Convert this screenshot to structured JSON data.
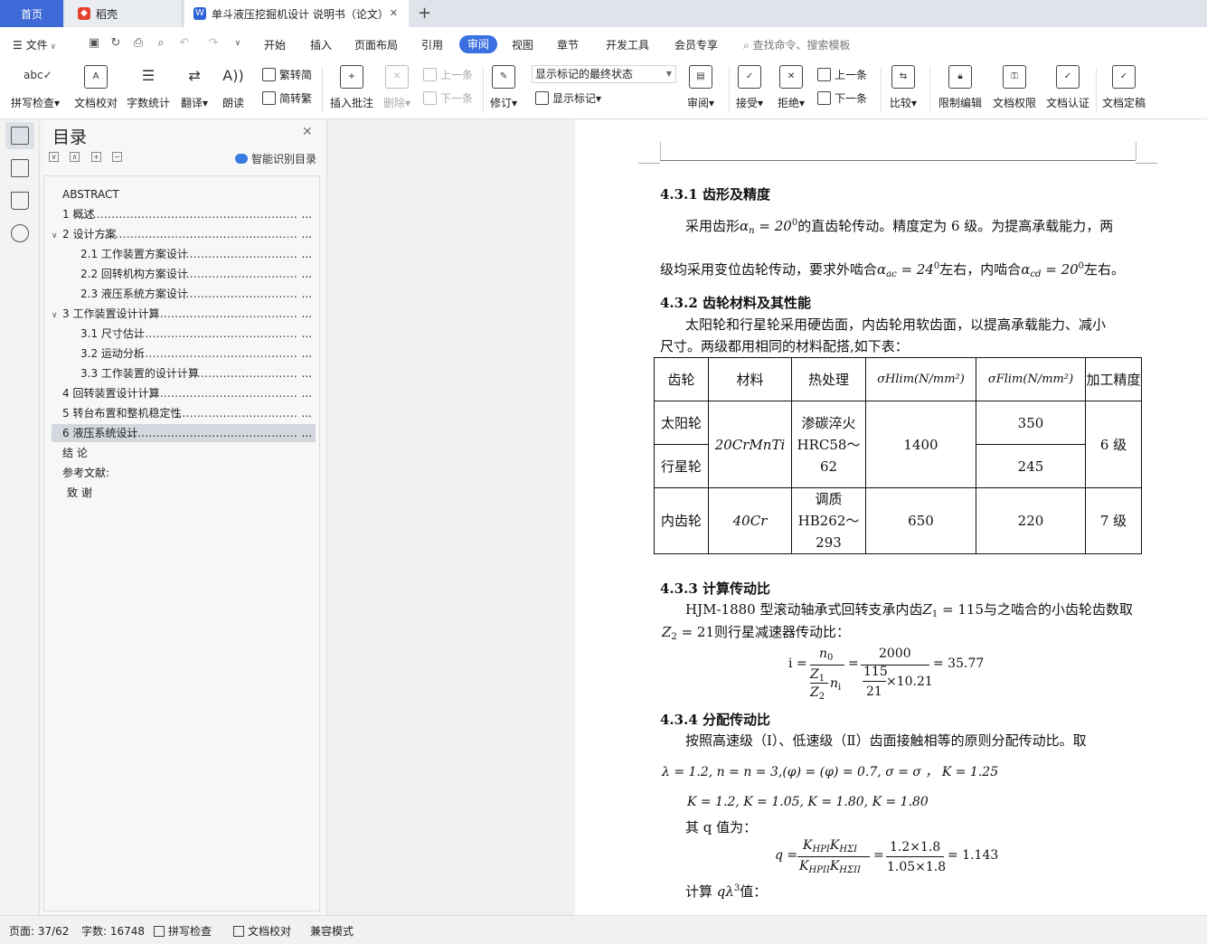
{
  "tabs": {
    "home": "首页",
    "daoke": "稻壳",
    "doc": "单斗液压挖掘机设计 说明书（论文）",
    "add": "+"
  },
  "menu": {
    "file": "文件",
    "items": [
      "开始",
      "插入",
      "页面布局",
      "引用",
      "审阅",
      "视图",
      "章节",
      "开发工具",
      "会员专享"
    ],
    "active": "审阅",
    "search": "查找命令、搜索模板"
  },
  "toolbar": {
    "spell": "拼写检查",
    "proof": "文档校对",
    "wordcount": "字数统计",
    "translate": "翻译",
    "read": "朗读",
    "to_trad": "繁转简",
    "to_simp": "简转繁",
    "insert_comment": "插入批注",
    "delete": "删除",
    "prev": "上一条",
    "next": "下一条",
    "revise": "修订",
    "markup_state": "显示标记的最终状态",
    "show_markup": "显示标记",
    "review": "审阅",
    "accept": "接受",
    "reject": "拒绝",
    "prev2": "上一条",
    "next2": "下一条",
    "compare": "比较",
    "restrict": "限制编辑",
    "permission": "文档权限",
    "certify": "文档认证",
    "finalize": "文档定稿"
  },
  "toc": {
    "title": "目录",
    "smart": "智能识别目录",
    "items": [
      {
        "label": "ABSTRACT",
        "end": ""
      },
      {
        "label": "1  概述",
        "end": "..."
      },
      {
        "label": "2  设计方案",
        "end": "..."
      },
      {
        "label": "2.1  工作装置方案设计",
        "end": "..."
      },
      {
        "label": "2.2  回转机构方案设计",
        "end": "..."
      },
      {
        "label": "2.3  液压系统方案设计",
        "end": "..."
      },
      {
        "label": "3  工作装置设计计算",
        "end": "..."
      },
      {
        "label": "3.1  尺寸估计",
        "end": "..."
      },
      {
        "label": "3.2  运动分析",
        "end": "..."
      },
      {
        "label": "3.3  工作装置的设计计算",
        "end": "..."
      },
      {
        "label": "4  回转装置设计计算",
        "end": "..."
      },
      {
        "label": "5  转台布置和整机稳定性",
        "end": "..."
      },
      {
        "label": "6  液压系统设计",
        "end": "..."
      },
      {
        "label": "结    论",
        "end": ""
      },
      {
        "label": "参考文献:",
        "end": ""
      },
      {
        "label": "致    谢",
        "end": ""
      }
    ]
  },
  "doc": {
    "h431": "4.3.1 齿形及精度",
    "p431a_1": "采用齿形",
    "p431a_2": "的直齿轮传动。精度定为 6 级。为提高承载能力，两",
    "alpha_n": "α",
    "alpha_n_sub": "n",
    "alpha_val": " = 20",
    "deg": "0",
    "p431b_1": "级均采用变位齿轮传动，要求外啮合",
    "p431b_2": "左右，内啮合",
    "p431b_3": "左右。",
    "ext_val": " = 24",
    "int_val": " = 20",
    "h432": "4.3.2 齿轮材料及其性能",
    "p432a": "太阳轮和行星轮采用硬齿面，内齿轮用软齿面，以提高承载能力、减小",
    "p432b": "尺寸。两级都用相同的材料配搭,如下表：",
    "table": {
      "headers": [
        "齿轮",
        "材料",
        "热处理",
        "σHlim(N/mm²)",
        "σFlim(N/mm²)",
        "加工精度"
      ],
      "r1_gear": "太阳轮",
      "r2_gear": "行星轮",
      "r12_material": "20CrMnTi",
      "r12_heat": "渗碳淬火HRC58～62",
      "r12_hlim": "1400",
      "r1_flim": "350",
      "r2_flim": "245",
      "r12_prec": "6 级",
      "r3_gear": "内齿轮",
      "r3_material": "40Cr",
      "r3_heat": "调质HB262～293",
      "r3_hlim": "650",
      "r3_flim": "220",
      "r3_prec": "7 级"
    },
    "h433": "4.3.3 计算传动比",
    "p433a_1": "HJM-1880 型滚动轴承式回转支承内齿",
    "p433a_z1": "Z",
    "p433a_z1v": " = 115",
    "p433a_2": "与之啮合的小齿轮齿数取",
    "p433b_z2v": " = 21",
    "p433b_2": "则行星减速器传动比：",
    "eq_i": "i =",
    "eq_n0": "n",
    "eq_ni": "n",
    "eq_2000": "2000",
    "eq_115": "115",
    "eq_21": "21",
    "eq_1021": "×10.21",
    "eq_result": "= 35.77",
    "h434": "4.3.4 分配传动比",
    "p434a": "按照高速级（Ⅰ）、低速级（Ⅱ）齿面接触相等的原则分配传动比。取",
    "p434b": "λ = 1.2, n = n = 3,(φ) = (φ) = 0.7, σ = σ ，  K = 1.25",
    "p434c": "K = 1.2, K = 1.05, K = 1.80, K = 1.80",
    "p434d": "其 q 值为：",
    "eq_q": "q =",
    "eq_q_num": "1.2×1.8",
    "eq_q_den": "1.05×1.8",
    "eq_q_res": "= 1.143",
    "p434e_1": "计算",
    "p434e_2": "值："
  },
  "status": {
    "page": "页面: 37/62",
    "words": "字数: 16748",
    "spell": "拼写检查",
    "proof": "文档校对",
    "compat": "兼容模式"
  }
}
